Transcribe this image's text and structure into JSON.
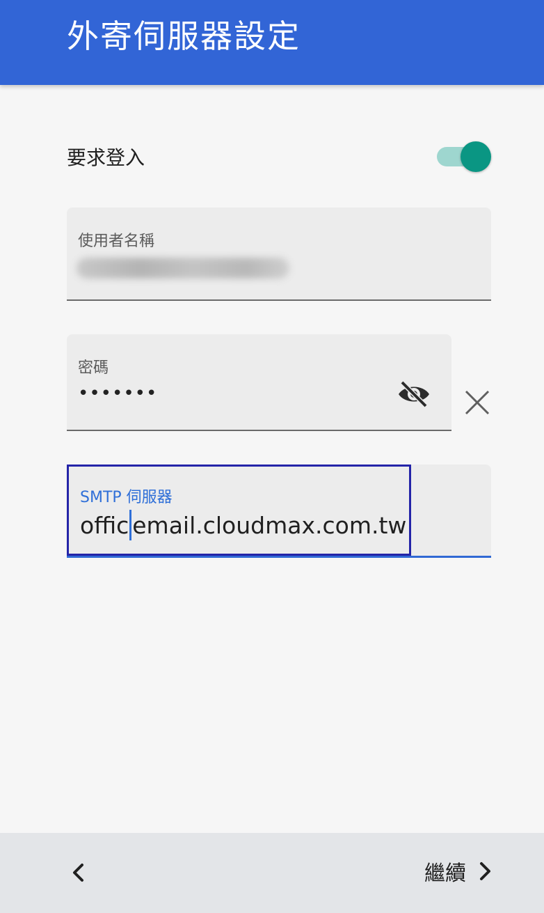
{
  "header": {
    "title": "外寄伺服器設定"
  },
  "require_login": {
    "label": "要求登入",
    "enabled": true
  },
  "username": {
    "label": "使用者名稱"
  },
  "password": {
    "label": "密碼",
    "value": "•••••••"
  },
  "smtp": {
    "label": "SMTP 伺服器",
    "value_before_cursor": "offic",
    "value_after_cursor": "email.cloudmax.com.tw"
  },
  "footer": {
    "next_label": "繼續"
  },
  "icons": {
    "password_visibility": "eye-off-icon",
    "clear": "close-icon",
    "back": "chevron-left-icon",
    "next": "chevron-right-icon"
  },
  "colors": {
    "appbar": "#3265d6",
    "toggle_thumb": "#0a9683",
    "toggle_track": "#9ed6cf",
    "focus": "#3069d4",
    "bottombar": "#e3e5e8"
  }
}
